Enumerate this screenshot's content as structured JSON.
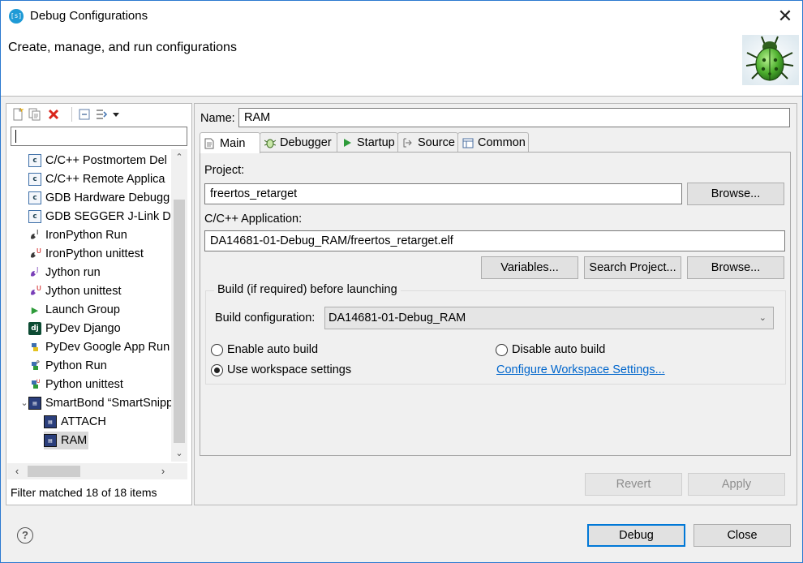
{
  "window": {
    "title": "Debug Configurations",
    "close_glyph": "✕"
  },
  "header": {
    "title": "Create, manage, and run configurations",
    "banner_icon": "bug-icon"
  },
  "toolbar": {
    "icons": [
      "new-configuration-icon",
      "duplicate-icon",
      "delete-icon",
      "collapse-all-icon",
      "filter-icon",
      "dropdown-icon"
    ]
  },
  "filter": {
    "value": "",
    "placeholder": ""
  },
  "tree": {
    "items": [
      {
        "label": "C/C++ Postmortem Del",
        "icon": "c-icon"
      },
      {
        "label": "C/C++ Remote Applica",
        "icon": "c-icon"
      },
      {
        "label": "GDB Hardware Debugg",
        "icon": "c-icon"
      },
      {
        "label": "GDB SEGGER J-Link Del",
        "icon": "c-icon"
      },
      {
        "label": "IronPython Run",
        "icon": "python-icon"
      },
      {
        "label": "IronPython unittest",
        "icon": "python-icon"
      },
      {
        "label": "Jython run",
        "icon": "python-icon"
      },
      {
        "label": "Jython unittest",
        "icon": "python-icon"
      },
      {
        "label": "Launch Group",
        "icon": "launch-icon"
      },
      {
        "label": "PyDev Django",
        "icon": "django-icon"
      },
      {
        "label": "PyDev Google App Run",
        "icon": "python-icon"
      },
      {
        "label": "Python Run",
        "icon": "python-icon"
      },
      {
        "label": "Python unittest",
        "icon": "python-icon"
      },
      {
        "label": "SmartBond “SmartSnipp",
        "icon": "smartbond-icon",
        "expanded": true
      },
      {
        "label": "ATTACH",
        "icon": "smartbond-icon"
      },
      {
        "label": "RAM",
        "icon": "smartbond-icon",
        "selected": true
      }
    ]
  },
  "filter_status": "Filter matched 18 of 18 items",
  "config": {
    "name_label": "Name:",
    "name_value": "RAM"
  },
  "tabs": [
    {
      "label": "Main",
      "icon": "main-tab-icon",
      "active": true
    },
    {
      "label": "Debugger",
      "icon": "debugger-tab-icon"
    },
    {
      "label": "Startup",
      "icon": "startup-tab-icon"
    },
    {
      "label": "Source",
      "icon": "source-tab-icon"
    },
    {
      "label": "Common",
      "icon": "common-tab-icon"
    }
  ],
  "main": {
    "project_label": "Project:",
    "project_value": "freertos_retarget",
    "browse_label": "Browse...",
    "app_label": "C/C++ Application:",
    "app_value": "DA14681-01-Debug_RAM/freertos_retarget.elf",
    "variables_label": "Variables...",
    "search_project_label": "Search Project...",
    "build_group_title": "Build (if required) before launching",
    "build_config_label": "Build configuration:",
    "build_config_value": "DA14681-01-Debug_RAM",
    "radio_enable": "Enable auto build",
    "radio_disable": "Disable auto build",
    "radio_workspace": "Use workspace settings",
    "selected_radio": "Use workspace settings",
    "configure_link": "Configure Workspace Settings..."
  },
  "actions": {
    "revert": "Revert",
    "apply": "Apply",
    "debug": "Debug",
    "close": "Close",
    "help": "?"
  }
}
